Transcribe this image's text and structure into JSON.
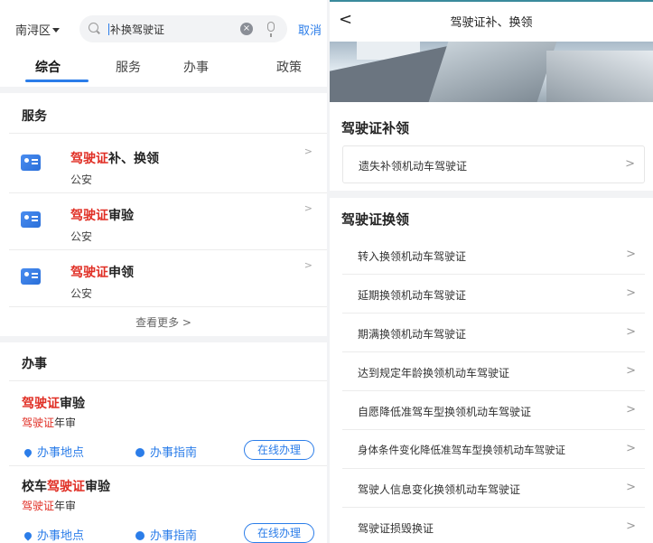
{
  "left": {
    "region": "南浔区",
    "search": {
      "query": "补换驾驶证"
    },
    "cancel_label": "取消",
    "tabs": [
      "综合",
      "服务",
      "办事",
      "政策"
    ],
    "services": {
      "title": "服务",
      "items": [
        {
          "highlight": "驾驶证",
          "rest": "补、换领",
          "dept": "公安"
        },
        {
          "highlight": "驾驶证",
          "rest": "审验",
          "dept": "公安"
        },
        {
          "highlight": "驾驶证",
          "rest": "申领",
          "dept": "公安"
        }
      ],
      "see_more": "查看更多 >"
    },
    "affairs": {
      "title": "办事",
      "items": [
        {
          "title_pre": "",
          "title_hl": "驾驶证",
          "title_rest": "审验",
          "sub_hl": "驾驶证",
          "sub_rest": "年审"
        },
        {
          "title_pre": "校车",
          "title_hl": "驾驶证",
          "title_rest": "审验",
          "sub_hl": "驾驶证",
          "sub_rest": "年审"
        }
      ],
      "location_label": "办事地点",
      "guide_label": "办事指南",
      "online_label": "在线办理"
    }
  },
  "right": {
    "header_title": "驾驶证补、换领",
    "section1": {
      "title": "驾驶证补领",
      "items": [
        "遗失补领机动车驾驶证"
      ]
    },
    "section2": {
      "title": "驾驶证换领",
      "items": [
        "转入换领机动车驾驶证",
        "延期换领机动车驾驶证",
        "期满换领机动车驾驶证",
        "达到规定年龄换领机动车驾驶证",
        "自愿降低准驾车型换领机动车驾驶证",
        "身体条件变化降低准驾车型换领机动车驾驶证",
        "驾驶人信息变化换领机动车驾驶证",
        "驾驶证损毁换证"
      ]
    }
  },
  "colors": {
    "accent": "#2b7de9",
    "highlight": "#e02e24"
  }
}
